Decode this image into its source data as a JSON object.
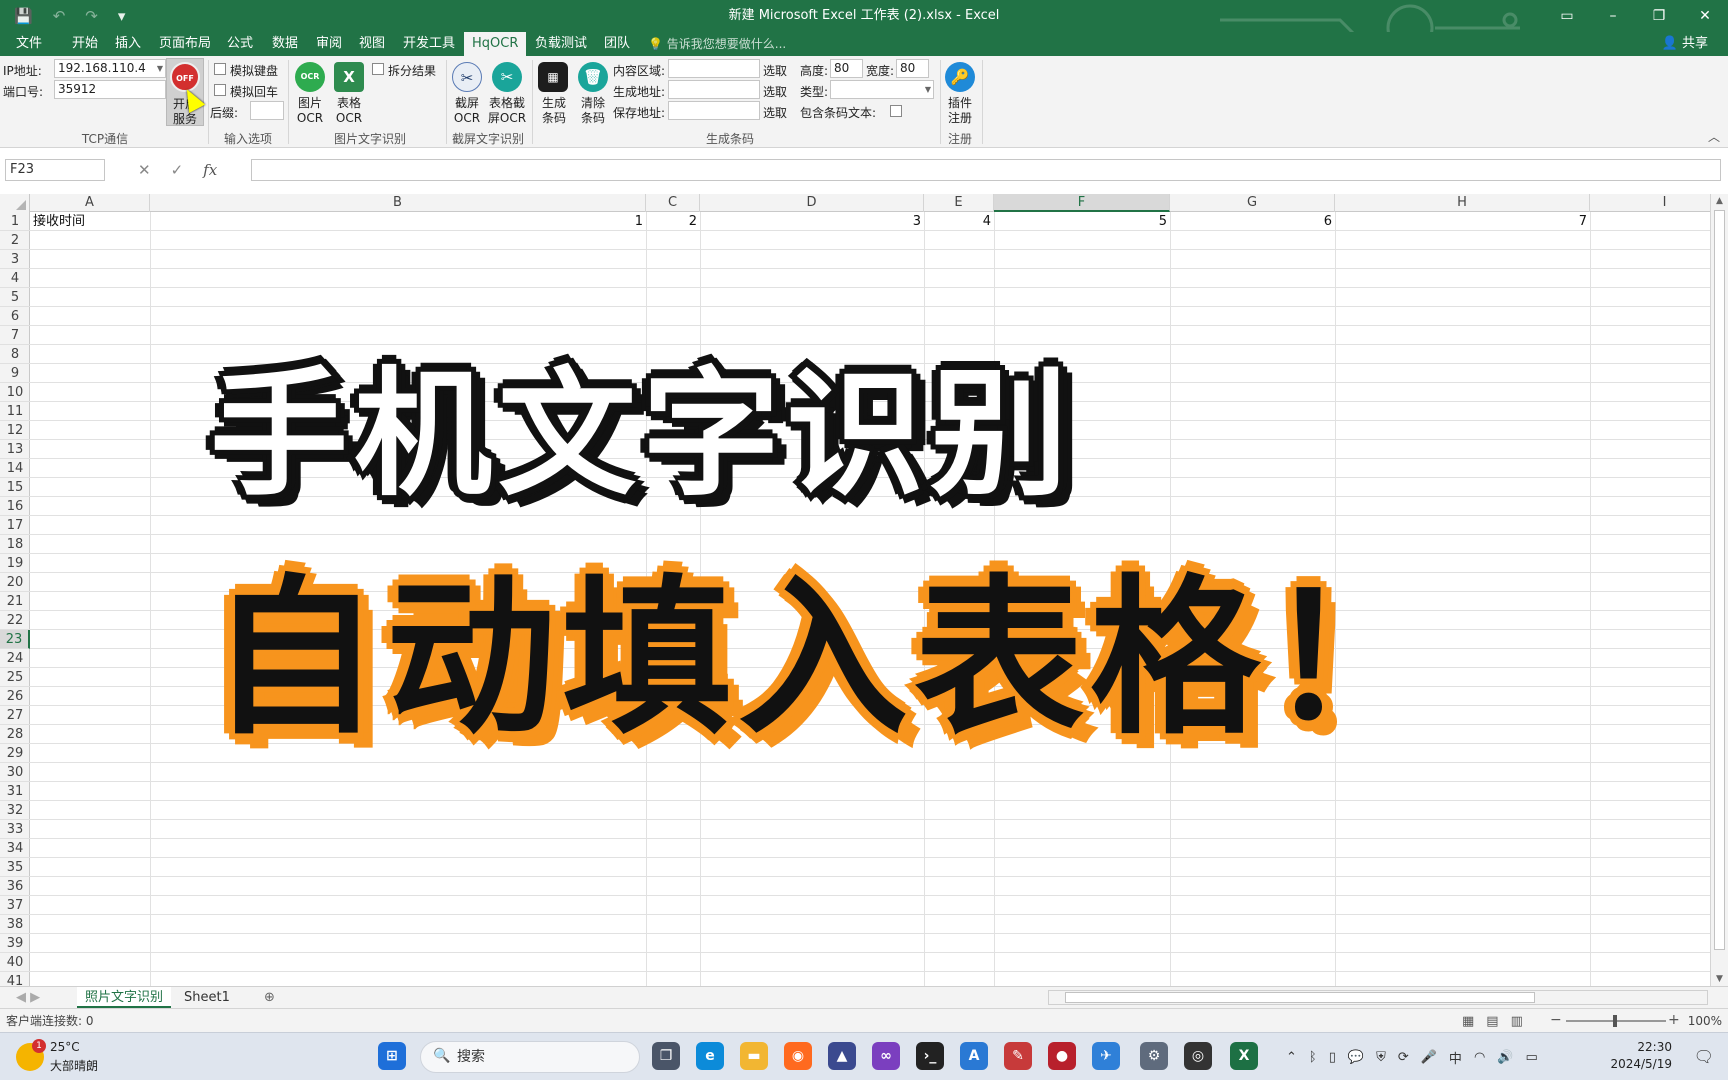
{
  "titlebar": {
    "title": "新建 Microsoft Excel 工作表 (2).xlsx - Excel",
    "minimize": "–",
    "maximize": "❐",
    "close": "✕"
  },
  "menu": {
    "tabs": [
      "文件",
      "开始",
      "插入",
      "页面布局",
      "公式",
      "数据",
      "审阅",
      "视图",
      "开发工具",
      "HqOCR",
      "负载测试",
      "团队"
    ],
    "active": "HqOCR",
    "tell_me": "告诉我您想要做什么...",
    "share": "共享"
  },
  "ribbon": {
    "tcp": {
      "ip_label": "IP地址:",
      "ip_value": "192.168.110.4",
      "port_label": "端口号:",
      "port_value": "35912",
      "off_badge": "OFF",
      "start_label_1": "开启",
      "start_label_2": "服务",
      "group": "TCP通信"
    },
    "input": {
      "sim_keyboard": "模拟键盘",
      "sim_enter": "模拟回车",
      "suffix_label": "后缀:",
      "group": "输入选项"
    },
    "image_ocr": {
      "image_btn_1": "图片",
      "image_btn_2": "OCR",
      "table_btn_1": "表格",
      "table_btn_2": "OCR",
      "split_results": "拆分结果",
      "group": "图片文字识别"
    },
    "screen_ocr": {
      "screen_btn_1": "截屏",
      "screen_btn_2": "OCR",
      "table_screen_btn_1": "表格截",
      "table_screen_btn_2": "屏OCR",
      "group": "截屏文字识别"
    },
    "barcode": {
      "gen_btn_1": "生成",
      "gen_btn_2": "条码",
      "clear_btn_1": "清除",
      "clear_btn_2": "条码",
      "content_area": "内容区域:",
      "gen_address": "生成地址:",
      "save_address": "保存地址:",
      "pick": "选取",
      "height_label": "高度:",
      "height_value": "80",
      "width_label": "宽度:",
      "width_value": "80",
      "type_label": "类型:",
      "include_text": "包含条码文本:",
      "group": "生成条码"
    },
    "register": {
      "btn_1": "插件",
      "btn_2": "注册",
      "group": "注册"
    }
  },
  "formula": {
    "namebox": "F23",
    "cancel": "✕",
    "enter": "✓",
    "fx": "fx",
    "value": ""
  },
  "grid": {
    "columns": [
      "A",
      "B",
      "C",
      "D",
      "E",
      "F",
      "G",
      "H",
      "I"
    ],
    "selected_col": "F",
    "selected_row": "23",
    "rows": [
      "1",
      "2",
      "3",
      "4",
      "5",
      "6",
      "7",
      "8",
      "9",
      "10",
      "11",
      "12",
      "13",
      "14",
      "15",
      "16",
      "17",
      "18",
      "19",
      "20",
      "21",
      "22",
      "23",
      "24",
      "25",
      "26",
      "27",
      "28",
      "29",
      "30",
      "31",
      "32",
      "33",
      "34",
      "35",
      "36",
      "37",
      "38",
      "39",
      "40",
      "41"
    ],
    "row1": {
      "A": "接收时间",
      "B": "1",
      "C": "2",
      "D": "3",
      "E": "4",
      "F": "5",
      "G": "6",
      "H": "7"
    }
  },
  "overlay": {
    "line1": "手机文字识别",
    "line2": "自动填入表格！"
  },
  "sheets": {
    "tabs": [
      "照片文字识别",
      "Sheet1"
    ],
    "active": "照片文字识别",
    "add": "⊕"
  },
  "status": {
    "left": "客户端连接数: 0",
    "zoom": "100%"
  },
  "taskbar": {
    "weather_temp": "25°C",
    "weather_desc": "大部晴朗",
    "weather_badge": "1",
    "search_placeholder": "搜索",
    "time": "22:30",
    "date": "2024/5/19",
    "ime": "中"
  },
  "colors": {
    "excel_green": "#217346",
    "overlay_orange": "#f7941d"
  }
}
